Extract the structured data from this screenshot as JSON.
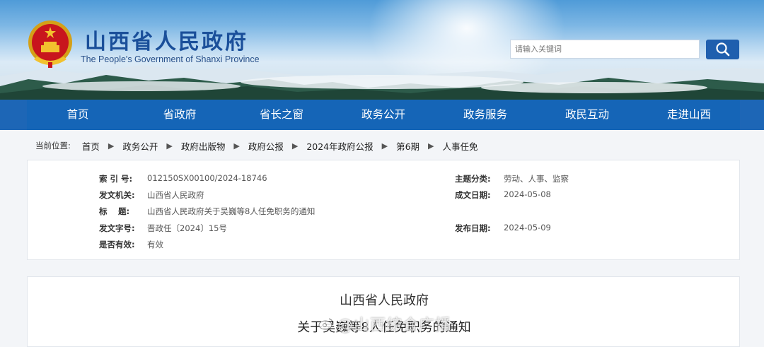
{
  "header": {
    "title": "山西省人民政府",
    "subtitle": "The People's Government of Shanxi Province",
    "search_placeholder": "请输入关键词"
  },
  "nav": {
    "items": [
      "首页",
      "省政府",
      "省长之窗",
      "政务公开",
      "政务服务",
      "政民互动",
      "走进山西"
    ]
  },
  "breadcrumb": {
    "prefix": "当前位置:",
    "items": [
      "首页",
      "政务公开",
      "政府出版物",
      "政府公报",
      "2024年政府公报",
      "第6期",
      "人事任免"
    ],
    "separator": "▶"
  },
  "info": {
    "index_label": "索 引 号:",
    "index_value": "012150SX00100/2024-18746",
    "category_label": "主题分类:",
    "category_value": "劳动、人事、监察",
    "issuer_label": "发文机关:",
    "issuer_value": "山西省人民政府",
    "created_label": "成文日期:",
    "created_value": "2024-05-08",
    "title_label": "标　 题:",
    "title_value": "山西省人民政府关于吴巍等8人任免职务的通知",
    "docno_label": "发文字号:",
    "docno_value": "晋政任〔2024〕15号",
    "published_label": "发布日期:",
    "published_value": "2024-05-09",
    "valid_label": "是否有效:",
    "valid_value": "有效"
  },
  "content": {
    "org": "山西省人民政府",
    "title": "关于吴巍等8人任免职务的通知"
  },
  "watermark": {
    "text": "@山西综合广播"
  },
  "colors": {
    "nav_bg": "#1565b7",
    "title_blue": "#1a4f9a",
    "search_btn": "#1f5fae"
  },
  "icons": {
    "emblem": "national-emblem-icon",
    "search": "search-icon",
    "weibo": "weibo-icon"
  }
}
